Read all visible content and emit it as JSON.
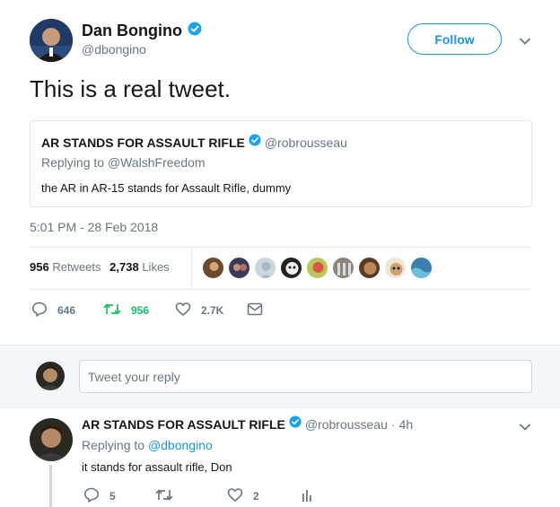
{
  "tweet": {
    "author_name": "Dan Bongino",
    "author_handle": "@dbongino",
    "follow_label": "Follow",
    "text": "This is a real tweet.",
    "timestamp": "5:01 PM - 28 Feb 2018",
    "retweets_count": "956",
    "retweets_label": "Retweets",
    "likes_count": "2,738",
    "likes_label": "Likes",
    "actions": {
      "reply_count": "646",
      "retweet_count": "956",
      "like_count": "2.7K"
    }
  },
  "quoted": {
    "author_name": "AR STANDS FOR ASSAULT RIFLE",
    "author_handle": "@robrousseau",
    "replying_prefix": "Replying to",
    "replying_to": "@WalshFreedom",
    "text": "the AR in AR-15 stands for Assault Rifle, dummy"
  },
  "reply_box": {
    "placeholder": "Tweet your reply"
  },
  "reply": {
    "author_name": "AR STANDS FOR ASSAULT RIFLE",
    "author_handle": "@robrousseau",
    "separator": "·",
    "time": "4h",
    "replying_prefix": "Replying to",
    "replying_to": "@dbongino",
    "text": "it stands for assault rifle, Don",
    "actions": {
      "reply_count": "5",
      "like_count": "2"
    }
  },
  "colors": {
    "brand_blue": "#1b95e0",
    "retweet_green": "#17bf63",
    "muted": "#657786",
    "divider": "#e6ecf0"
  },
  "icons": {
    "verified": "verified-badge-icon",
    "chevron": "chevron-down-icon",
    "reply": "reply-icon",
    "retweet": "retweet-icon",
    "like": "heart-icon",
    "dm": "envelope-icon",
    "analytics": "analytics-icon"
  }
}
